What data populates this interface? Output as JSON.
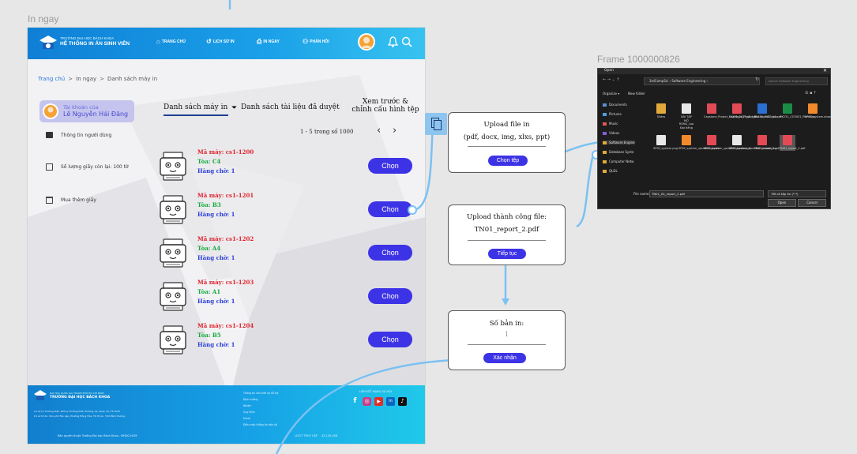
{
  "frame_title": "In ngay",
  "header": {
    "logo_line1": "TRƯỜNG ĐẠI HỌC BÁCH KHOA",
    "logo_line2": "HỆ THỐNG IN ẤN SINH VIÊN",
    "nav": [
      "TRANG CHỦ",
      "LỊCH SỬ IN",
      "IN NGAY",
      "PHẢN HỒI"
    ]
  },
  "breadcrumb": {
    "items": [
      "Trang chủ",
      "In ngay",
      "Danh sách máy in"
    ],
    "sep": ">"
  },
  "sidebar": {
    "account_label": "Tài khoản của",
    "account_name": "Lê Nguyễn Hải Đăng",
    "items": [
      "Thông tin người dùng",
      "Số lượng giấy còn lại: 100 tờ",
      "Mua thêm giấy"
    ]
  },
  "tabs": {
    "printers": "Danh sách máy in",
    "docs": "Danh sách tài liệu đã duyệt",
    "preview_line1": "Xem trước &",
    "preview_line2": "chỉnh cấu hình tệp"
  },
  "pagination": {
    "text": "1 - 5 trong số 1000",
    "prev": "‹",
    "next": "›"
  },
  "printers": [
    {
      "id": "Mã máy: cs1-1200",
      "building": "Tòa: C4",
      "queue": "Hàng chờ: 1",
      "button": "Chọn"
    },
    {
      "id": "Mã máy: cs1-1201",
      "building": "Tòa: B3",
      "queue": "Hàng chờ: 1",
      "button": "Chọn"
    },
    {
      "id": "Mã máy: cs1-1202",
      "building": "Tòa: A4",
      "queue": "Hàng chờ: 1",
      "button": "Chọn"
    },
    {
      "id": "Mã máy: cs1-1203",
      "building": "Tòa: A1",
      "queue": "Hàng chờ: 1",
      "button": "Chọn"
    },
    {
      "id": "Mã máy: cs1-1204",
      "building": "Tòa: B5",
      "queue": "Hàng chờ: 1",
      "button": "Chọn"
    }
  ],
  "footer": {
    "uni_line1": "ĐẠI HỌC QUỐC GIA THÀNH PHỐ HỒ CHÍ MINH",
    "uni_line2": "TRƯỜNG ĐẠI HỌC BÁCH KHOA",
    "addr1": "Cơ sở Lý Thường Kiệt: 268 Lý Thường Kiệt, Phường 14, Quận 10, TP. HCM",
    "addr2": "Cơ sở Dĩ An: Khu phố Tân Lập, Phường Đông Hòa, TP. Dĩ An, Tỉnh Bình Dương",
    "links": [
      "Thông tin cần biết và hỗ trợ",
      "Định hướng",
      "Nhiệm",
      "Quy Định",
      "Email",
      "Điều mấu thông tin bảo vệ"
    ],
    "connect": "LIÊN KẾT MẠNG XÃ HỘI",
    "social": [
      "f",
      "◎",
      "▶",
      "in",
      "♪"
    ],
    "copyright": "Bản quyền thuộc Trường Đại học Bách Khoa - ĐHQG-HCM",
    "visits_label": "LƯỢT TRUY CẬP",
    "visits": "42,120,058"
  },
  "upload_card": {
    "title": "Upload file in",
    "formats": "(pdf, docx, img, xlxs, ppt)",
    "button": "Chọn tệp"
  },
  "success_card": {
    "title": "Upload thành công file:",
    "filename": "TN01_report_2.pdf",
    "button": "Tiếp tục"
  },
  "copies_card": {
    "title": "Số bản in:",
    "value": "1",
    "button": "Xác nhận"
  },
  "frame2_title": "Frame 1000000826",
  "dialog": {
    "title": "Open",
    "path": "3rdCompSci › Software Engineering ›",
    "search_placeholder": "Search Software Engineering",
    "organize": "Organize ▾",
    "new_folder": "New folder",
    "nav": [
      "Documents",
      "Pictures",
      "Music",
      "Videos",
      "Software Engine",
      "Database Syste",
      "Computer Netw",
      "QLDL"
    ],
    "files": [
      {
        "name": "Slides",
        "color": "#e2a93a"
      },
      {
        "name": "BÀI TẬP MỞ RỘNG_Lop Đại tiếng",
        "color": "#e8e8e8"
      },
      {
        "name": "Capstone_Project_hk231_2023_s2.pdf",
        "color": "#e24a55"
      },
      {
        "name": "Capstone_Project_hk231_2023_s3.pdf",
        "color": "#e24a55"
      },
      {
        "name": "Document1.docx",
        "color": "#2b6fd1"
      },
      {
        "name": "HK231_CO3001_Plan.xlsx",
        "color": "#1c8b45"
      },
      {
        "name": "SPSS_system.drawio",
        "color": "#f08a2a"
      },
      {
        "name": "SPSS_system.png",
        "color": "#e8e8e8"
      },
      {
        "name": "SPSS_system_updated.drawio",
        "color": "#f08a2a"
      },
      {
        "name": "SPSS_system_updated.drawio.pdf",
        "color": "#e24a55"
      },
      {
        "name": "SPSS_system_updated.drawio.png",
        "color": "#e8e8e8"
      },
      {
        "name": "TN01_report_1.pdf",
        "color": "#e24a55"
      },
      {
        "name": "TN01_report_2.pdf",
        "color": "#e24a55"
      }
    ],
    "filename_label": "File name:",
    "filename": "TN01_04_report_2.pdf",
    "filetype": "Tất cả tệp tin (*.*)",
    "open": "Open",
    "cancel": "Cancel"
  },
  "colors": {
    "primary": "#3d33e6",
    "header": "#1a9ae6",
    "connector": "#7bc1f2"
  }
}
